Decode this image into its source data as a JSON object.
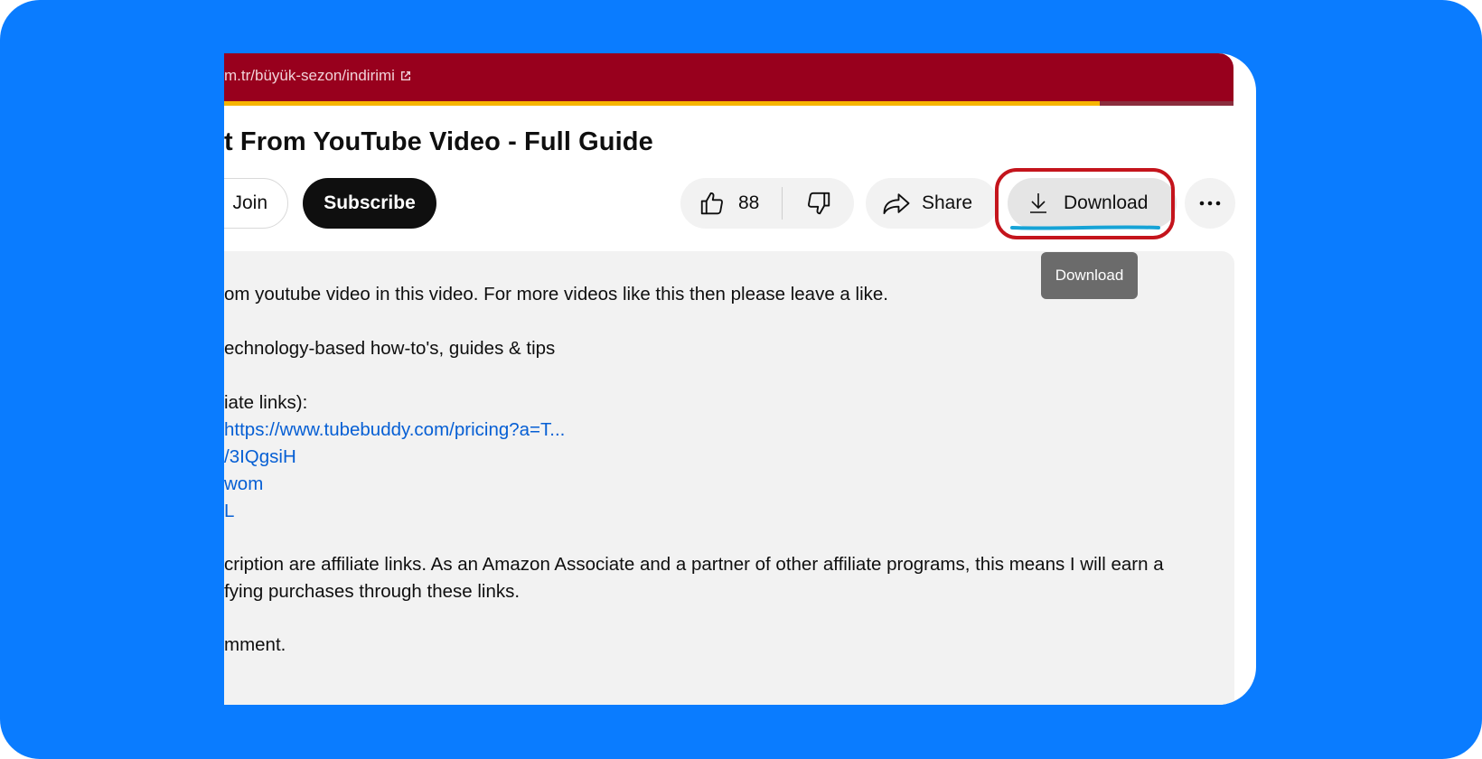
{
  "banner": {
    "link_text": "m.tr/büyük-sezon/indirimi",
    "link_icon": "external-link-icon"
  },
  "video": {
    "title": "t From YouTube Video - Full Guide"
  },
  "actions": {
    "join_label": "Join",
    "subscribe_label": "Subscribe",
    "like_count": "88",
    "share_label": "Share",
    "download_label": "Download",
    "more_icon": "more-horizontal-icon"
  },
  "tooltip": {
    "text": "Download"
  },
  "description": {
    "lines": [
      {
        "text": "om youtube video in this video. For more videos like this then please leave a like.",
        "type": "text"
      },
      {
        "text": "echnology-based how-to's, guides & tips",
        "type": "text"
      },
      {
        "text": "iate links):",
        "type": "text"
      },
      {
        "text": "https://www.tubebuddy.com/pricing?a=T...",
        "type": "link"
      },
      {
        "text": "/3IQgsiH",
        "type": "link"
      },
      {
        "text": "wom",
        "type": "link"
      },
      {
        "text": "L",
        "type": "link"
      },
      {
        "text": "cription are affiliate links. As an Amazon Associate and a partner of other affiliate programs, this means I will earn a",
        "type": "text"
      },
      {
        "text": "fying purchases through these links.",
        "type": "text"
      },
      {
        "text": "mment.",
        "type": "text"
      }
    ]
  },
  "colors": {
    "page_background": "#0a7cff",
    "banner": "#98001d",
    "banner_stripe": "#f7b500",
    "highlight_ring": "#c4141c",
    "underline": "#16a3d6",
    "link": "#065fd4"
  }
}
